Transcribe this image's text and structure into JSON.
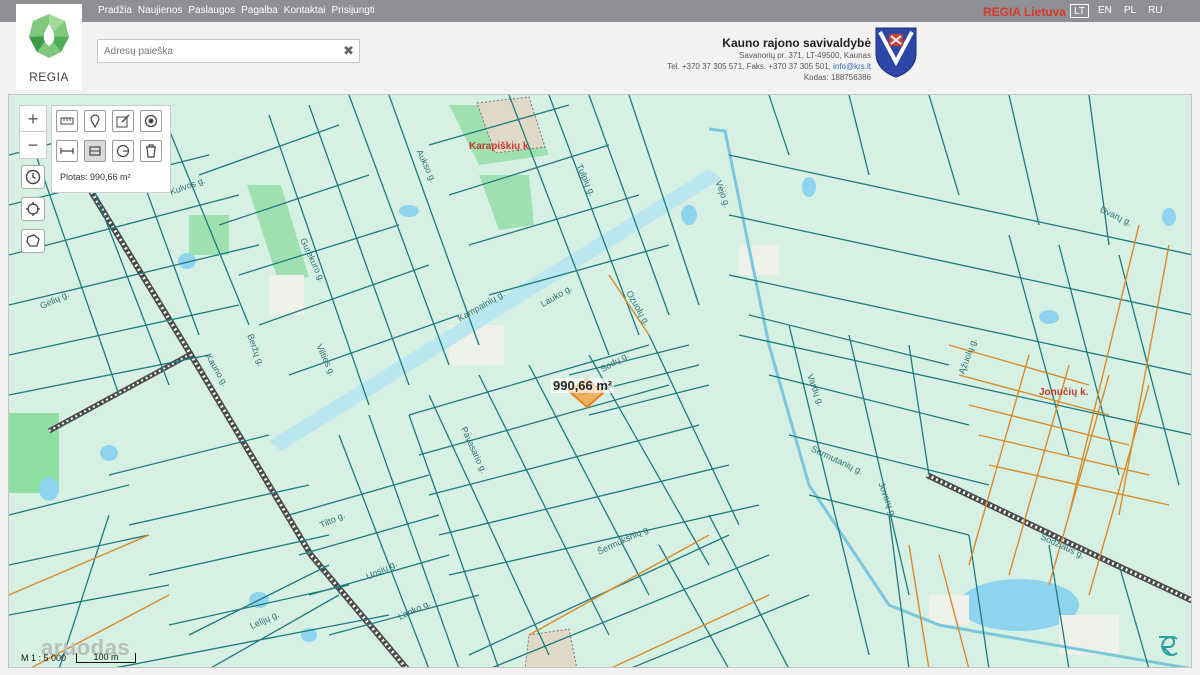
{
  "topnav": {
    "items": [
      "Pradžia",
      "Naujienos",
      "Paslaugos",
      "Pagalba",
      "Kontaktai",
      "Prisijungti"
    ]
  },
  "brand": {
    "link": "REGIA Lietuva",
    "color": "#d9392b"
  },
  "languages": {
    "items": [
      "LT",
      "EN",
      "PL",
      "RU"
    ],
    "active": "LT"
  },
  "logo": {
    "text": "REGIA"
  },
  "search": {
    "placeholder": "Adresų paieška",
    "value": ""
  },
  "municipality": {
    "name": "Kauno rajono savivaldybė",
    "address": "Savanorių pr. 371, LT-49500, Kaunas",
    "phone": "Tel. +370 37 305 571, Faks. +370 37 305 501, ",
    "email": "info@krs.lt",
    "code": "Kodas: 188756386"
  },
  "tools": {
    "row1": [
      "ruler-icon",
      "pin-icon",
      "edit-icon",
      "target-icon"
    ],
    "row2": [
      "measure-distance-icon",
      "measure-area-icon",
      "measure-radius-icon",
      "trash-icon"
    ],
    "area_label": "Plotas: 990,66 m²"
  },
  "map": {
    "measure_label": "990,66 m²",
    "villages": [
      "Karapiškių k.",
      "Jonučių k."
    ],
    "streets": [
      "Kulvos g.",
      "Aukso g.",
      "Tulpių g.",
      "Gėlių g.",
      "Gurekuro g.",
      "Vilties g.",
      "Kampainių g.",
      "Kauno g.",
      "Lauko g.",
      "Vėjo g.",
      "Ozuolų g.",
      "Pavasario g.",
      "Sodų g.",
      "Sermutanių g.",
      "Beržų g.",
      "Vardų g.",
      "Uosių g.",
      "Lanko g.",
      "Dvarų g.",
      "Ąžuolų g.",
      "Sodžiaus g.",
      "Jovarų g.",
      "Šermukšnių g.",
      "Lelijų g.",
      "Tilto g."
    ],
    "scale_ratio": "M 1 : 5 000",
    "scale_bar": "100 m",
    "watermark": "aruodas",
    "colors": {
      "background": "#d6f1e3",
      "parcel": "#1f7a7d",
      "road": "#b9e6ef",
      "railway": "#4a4a4a",
      "orange_parcel": "#d98a2a",
      "water": "#9fd6ee",
      "building": "#cfcfcf",
      "forest": "#9fe0b0"
    }
  }
}
